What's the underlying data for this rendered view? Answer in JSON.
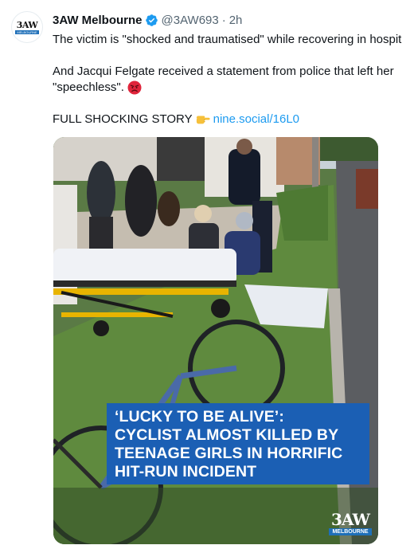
{
  "account": {
    "avatar_top": "3AW",
    "avatar_bottom": "MELBOURNE",
    "name": "3AW Melbourne",
    "handle": "@3AW693",
    "separator": "·",
    "time": "2h"
  },
  "tweet": {
    "line1": "The victim is \"shocked and traumatised\" while recovering in hospit",
    "line2": "And Jacqui Felgate received a statement from police that left her",
    "line3": "\"speechless\".",
    "story_prefix": "FULL SHOCKING STORY",
    "link": "nine.social/16L0"
  },
  "icons": {
    "verified": "verified-badge-icon",
    "angry": "angry-face-emoji",
    "pointing": "pointing-right-emoji"
  },
  "media": {
    "headline_lines": [
      "‘LUCKY TO BE ALIVE’:",
      "CYCLIST ALMOST KILLED BY",
      "TEENAGE GIRLS IN HORRIFIC",
      "HIT-RUN INCIDENT"
    ],
    "logo_big": "3AW",
    "logo_small": "MELBOURNE",
    "headline_color": "#1b5fb4"
  },
  "colors": {
    "link": "#1d9bf0",
    "secondary_text": "#536471",
    "verified": "#1d9bf0",
    "brand_blue": "#1e6fb8"
  }
}
